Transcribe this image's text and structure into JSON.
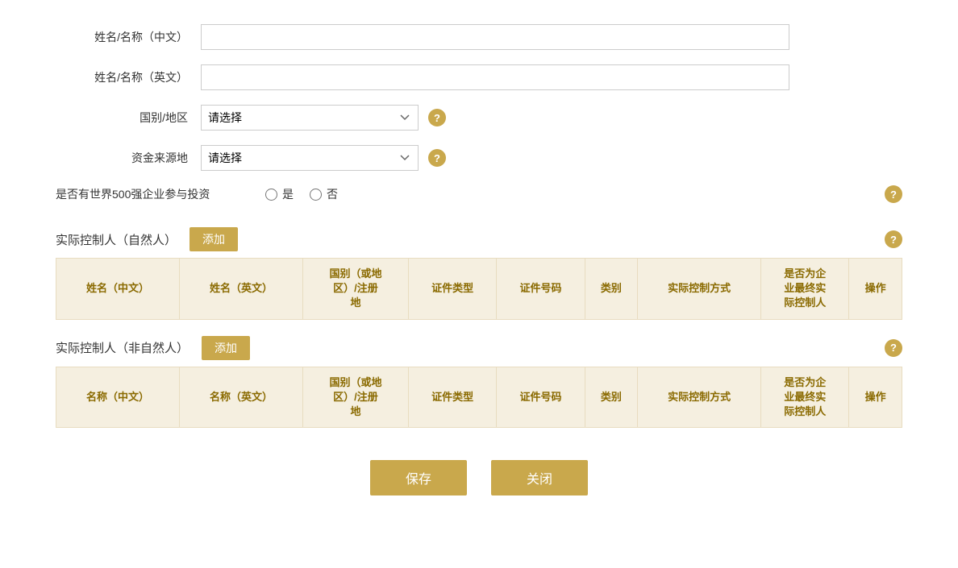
{
  "form": {
    "name_cn_label": "姓名/名称（中文）",
    "name_en_label": "姓名/名称（英文）",
    "country_label": "国别/地区",
    "country_placeholder": "请选择",
    "fund_source_label": "资金来源地",
    "fund_source_placeholder": "请选择",
    "fortune500_label": "是否有世界500强企业参与投资",
    "fortune500_yes": "是",
    "fortune500_no": "否",
    "section1_title": "实际控制人（自然人）",
    "section2_title": "实际控制人（非自然人）",
    "add_label": "添加",
    "help_icon": "?",
    "table1": {
      "headers": [
        "姓名（中文）",
        "姓名（英文）",
        "国别（或地区）/注册地",
        "证件类型",
        "证件号码",
        "类别",
        "实际控制方式",
        "是否为企业最终实际控制人",
        "操作"
      ]
    },
    "table2": {
      "headers": [
        "名称（中文）",
        "名称（英文）",
        "国别（或地区）/注册地",
        "证件类型",
        "证件号码",
        "类别",
        "实际控制方式",
        "是否为企业最终实际控制人",
        "操作"
      ]
    },
    "save_label": "保存",
    "close_label": "关闭"
  }
}
